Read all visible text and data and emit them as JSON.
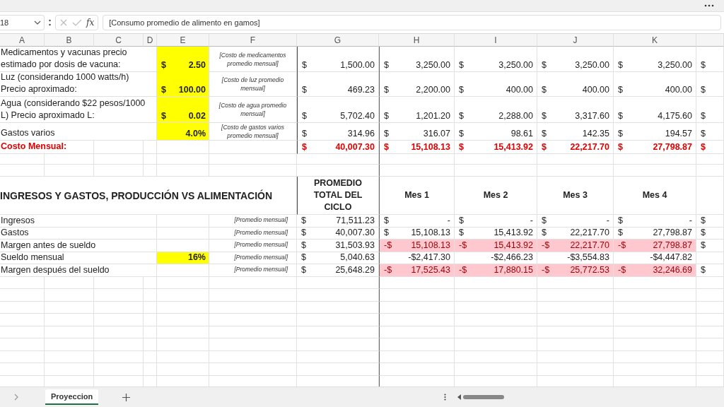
{
  "formula_bar": {
    "cell_ref": "18",
    "function_label": "fx",
    "formula": "[Consumo promedio de alimento en gamos]"
  },
  "columns": [
    "A",
    "B",
    "C",
    "D",
    "E",
    "F",
    "G",
    "H",
    "I",
    "J",
    "K"
  ],
  "costs": {
    "rows": [
      {
        "label": "Medicamentos y vacunas precio estimado por dosis de vacuna:",
        "input": {
          "currency": "$",
          "value": "2.50"
        },
        "note": "[Costo de medicamentos promedio mensual]",
        "values": [
          {
            "currency": "$",
            "value": "1,500.00"
          },
          {
            "currency": "$",
            "value": "3,250.00"
          },
          {
            "currency": "$",
            "value": "3,250.00"
          },
          {
            "currency": "$",
            "value": "3,250.00"
          },
          {
            "currency": "$",
            "value": "3,250.00"
          }
        ],
        "overflow": "$"
      },
      {
        "label": "Luz (considerando 1000 watts/h) Precio aproximado:",
        "input": {
          "currency": "$",
          "value": "100.00"
        },
        "note": "[Costo de luz promedio mensual]",
        "values": [
          {
            "currency": "$",
            "value": "469.23"
          },
          {
            "currency": "$",
            "value": "2,200.00"
          },
          {
            "currency": "$",
            "value": "400.00"
          },
          {
            "currency": "$",
            "value": "400.00"
          },
          {
            "currency": "$",
            "value": "400.00"
          }
        ],
        "overflow": "$"
      },
      {
        "label": "Agua (considerando $22 pesos/1000 L) Precio aproximado L:",
        "input": {
          "currency": "$",
          "value": "0.02"
        },
        "note": "[Costo de agua promedio mensual]",
        "values": [
          {
            "currency": "$",
            "value": "5,702.40"
          },
          {
            "currency": "$",
            "value": "1,201.20"
          },
          {
            "currency": "$",
            "value": "2,288.00"
          },
          {
            "currency": "$",
            "value": "3,317.60"
          },
          {
            "currency": "$",
            "value": "4,175.60"
          }
        ],
        "overflow": "$"
      },
      {
        "label": "Gastos varios",
        "input": {
          "value": "4.0%"
        },
        "note": "[Costo de gastos varios promedio mensual]",
        "values": [
          {
            "currency": "$",
            "value": "314.96"
          },
          {
            "currency": "$",
            "value": "316.07"
          },
          {
            "currency": "$",
            "value": "98.61"
          },
          {
            "currency": "$",
            "value": "142.35"
          },
          {
            "currency": "$",
            "value": "194.57"
          }
        ],
        "overflow": "$"
      }
    ],
    "total": {
      "label": "Costo Mensual:",
      "values": [
        {
          "currency": "$",
          "value": "40,007.30"
        },
        {
          "currency": "$",
          "value": "15,108.13"
        },
        {
          "currency": "$",
          "value": "15,413.92"
        },
        {
          "currency": "$",
          "value": "22,217.70"
        },
        {
          "currency": "$",
          "value": "27,798.87"
        }
      ],
      "overflow": "$"
    }
  },
  "summary": {
    "title": "INGRESOS Y GASTOS, PRODUCCIÓN VS ALIMENTACIÓN",
    "total_header": "PROMEDIO TOTAL DEL CICLO",
    "month_headers": [
      "Mes 1",
      "Mes 2",
      "Mes 3",
      "Mes 4"
    ],
    "rows": [
      {
        "label": "Ingresos",
        "note": "[Promedio mensual]",
        "total": {
          "currency": "$",
          "value": "71,511.23"
        },
        "months": [
          {
            "currency": "$",
            "value": "-",
            "negative": false
          },
          {
            "currency": "$",
            "value": "-",
            "negative": false
          },
          {
            "currency": "$",
            "value": "-",
            "negative": false
          },
          {
            "currency": "$",
            "value": "-",
            "negative": false
          }
        ],
        "overflow": "$"
      },
      {
        "label": "Gastos",
        "note": "[Promedio mensual]",
        "total": {
          "currency": "$",
          "value": "40,007.30"
        },
        "months": [
          {
            "currency": "$",
            "value": "15,108.13",
            "negative": false
          },
          {
            "currency": "$",
            "value": "15,413.92",
            "negative": false
          },
          {
            "currency": "$",
            "value": "22,217.70",
            "negative": false
          },
          {
            "currency": "$",
            "value": "27,798.87",
            "negative": false
          }
        ],
        "overflow": "$"
      },
      {
        "label": "Margen antes de sueldo",
        "note": "[Promedio mensual]",
        "total": {
          "currency": "$",
          "value": "31,503.93"
        },
        "months": [
          {
            "currency": "-$",
            "value": "15,108.13",
            "negative": true
          },
          {
            "currency": "-$",
            "value": "15,413.92",
            "negative": true
          },
          {
            "currency": "-$",
            "value": "22,217.70",
            "negative": true
          },
          {
            "currency": "-$",
            "value": "27,798.87",
            "negative": true
          }
        ],
        "overflow": "$"
      },
      {
        "label": "Sueldo mensual",
        "input": {
          "value": "16%"
        },
        "note": "[Promedio mensual]",
        "total": {
          "currency": "$",
          "value": "5,040.63"
        },
        "months": [
          {
            "value": "-$2,417.30",
            "negative": false
          },
          {
            "value": "-$2,466.23",
            "negative": false
          },
          {
            "value": "-$3,554.83",
            "negative": false
          },
          {
            "value": "-$4,447.82",
            "negative": false
          }
        ]
      },
      {
        "label": "Margen después del sueldo",
        "note": "[Promedio mensual]",
        "total": {
          "currency": "$",
          "value": "25,648.29"
        },
        "months": [
          {
            "currency": "-$",
            "value": "17,525.43",
            "negative": true
          },
          {
            "currency": "-$",
            "value": "17,880.15",
            "negative": true
          },
          {
            "currency": "-$",
            "value": "25,772.53",
            "negative": true
          },
          {
            "currency": "-$",
            "value": "32,246.69",
            "negative": true
          }
        ],
        "overflow": "$"
      }
    ]
  },
  "sheet_tabs": [
    {
      "label": "Proyeccion",
      "selected": true
    }
  ]
}
